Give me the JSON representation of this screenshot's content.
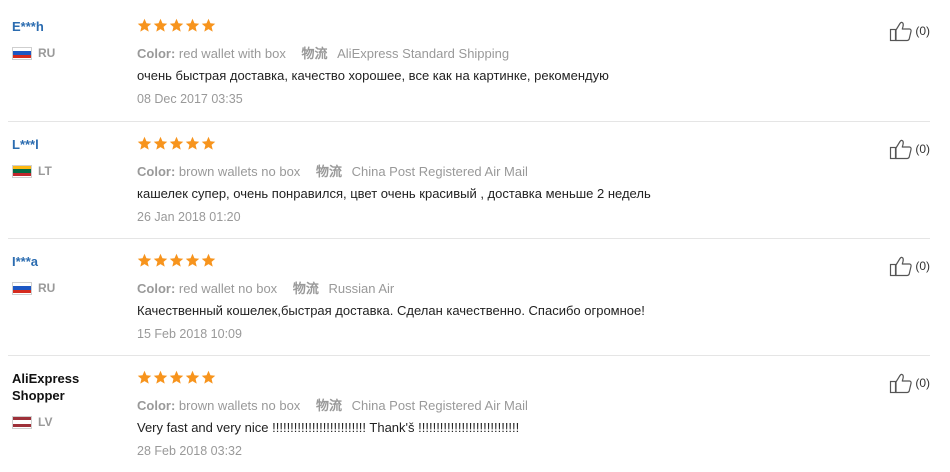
{
  "labels": {
    "color": "Color:",
    "shipping": "物流"
  },
  "reviews": [
    {
      "user": "E***h",
      "country": "RU",
      "flag_colors": [
        "#ffffff",
        "#1c57c4",
        "#d52b1e"
      ],
      "rating": 5,
      "color_value": "red wallet with box",
      "shipping_value": "AliExpress Standard Shipping",
      "text": "очень быстрая доставка, качество хорошее, все как на картинке, рекомендую",
      "date": "08 Dec 2017 03:35",
      "helpful": "(0)"
    },
    {
      "user": "L***l",
      "country": "LT",
      "flag_colors": [
        "#fdb913",
        "#006a44",
        "#c1272d"
      ],
      "rating": 5,
      "color_value": "brown wallets no box",
      "shipping_value": "China Post Registered Air Mail",
      "text": "кашелек супер, очень понравился, цвет очень красивый , доставка меньше 2 недель",
      "date": "26 Jan 2018 01:20",
      "helpful": "(0)"
    },
    {
      "user": "I***a",
      "country": "RU",
      "flag_colors": [
        "#ffffff",
        "#1c57c4",
        "#d52b1e"
      ],
      "rating": 5,
      "color_value": "red wallet no box",
      "shipping_value": "Russian Air",
      "text": "Качественный кошелек,быстрая доставка. Сделан качественно. Спасибо огромное!",
      "date": "15 Feb 2018 10:09",
      "helpful": "(0)"
    },
    {
      "user": "AliExpress Shopper",
      "country": "LV",
      "flag_colors": [
        "#9e3039",
        "#ffffff",
        "#9e3039"
      ],
      "rating": 5,
      "color_value": "brown wallets no box",
      "shipping_value": "China Post Registered Air Mail",
      "text": "Very fast and very nice !!!!!!!!!!!!!!!!!!!!!!!!!! Thank'š !!!!!!!!!!!!!!!!!!!!!!!!!!!!",
      "date": "28 Feb 2018 03:32",
      "helpful": "(0)"
    }
  ],
  "theme": {
    "star_color": "#f7941d",
    "link_color": "#2b6cb0",
    "muted_color": "#999999"
  }
}
